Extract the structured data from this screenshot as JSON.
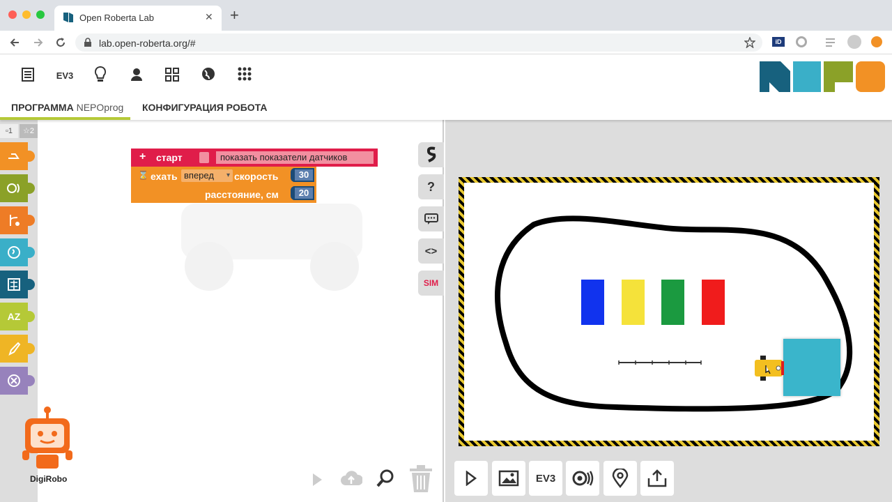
{
  "browser": {
    "tab_title": "Open Roberta Lab",
    "url": "lab.open-roberta.org/#",
    "tab_close": "✕",
    "new_tab": "+"
  },
  "app": {
    "nav_icons": [
      "document-icon",
      "ev3-icon",
      "lightbulb-icon",
      "user-icon",
      "gallery-icon",
      "globe-icon",
      "apps-icon"
    ],
    "ev3_label": "EV3",
    "tab_program_label": "ПРОГРАММА",
    "tab_program_name": "NEPOprog",
    "tab_config_label": "КОНФИГУРАЦИЯ РОБОТА",
    "logo_colors": [
      "#17617e",
      "#3aafc8",
      "#8ba128",
      "#f29125"
    ]
  },
  "toolbox": {
    "level1": "▫1",
    "level2": "☆2",
    "categories": [
      {
        "name": "action",
        "color": "#f29125"
      },
      {
        "name": "sensors",
        "color": "#8ba128"
      },
      {
        "name": "control",
        "color": "#ee7c26"
      },
      {
        "name": "logic",
        "color": "#3aafc8"
      },
      {
        "name": "math",
        "color": "#17617e"
      },
      {
        "name": "text",
        "color": "#b5c937"
      },
      {
        "name": "colors",
        "color": "#efb525"
      },
      {
        "name": "variables",
        "color": "#9782bc"
      }
    ],
    "az_label": "AZ"
  },
  "program": {
    "start_label": "старт",
    "show_sensors_label": "показать показатели датчиков",
    "drive_label": "ехать",
    "direction_value": "вперед",
    "speed_label": "скорость",
    "speed_value": "30",
    "distance_label": "расстояние, см",
    "distance_value": "20"
  },
  "side_buttons": {
    "help": "?",
    "code": "<>",
    "sim": "SIM"
  },
  "mascot": {
    "label": "DigiRobo"
  },
  "simulator": {
    "buttons": [
      "play-icon",
      "image-icon",
      "ev3-icon",
      "sensor-icon",
      "location-icon",
      "export-icon"
    ],
    "ev3_label": "EV3",
    "bars": [
      {
        "color": "#1133ee"
      },
      {
        "color": "#f5e23a"
      },
      {
        "color": "#1b9a40"
      },
      {
        "color": "#f01c1c"
      }
    ],
    "square_color": "#3ab5cb"
  }
}
